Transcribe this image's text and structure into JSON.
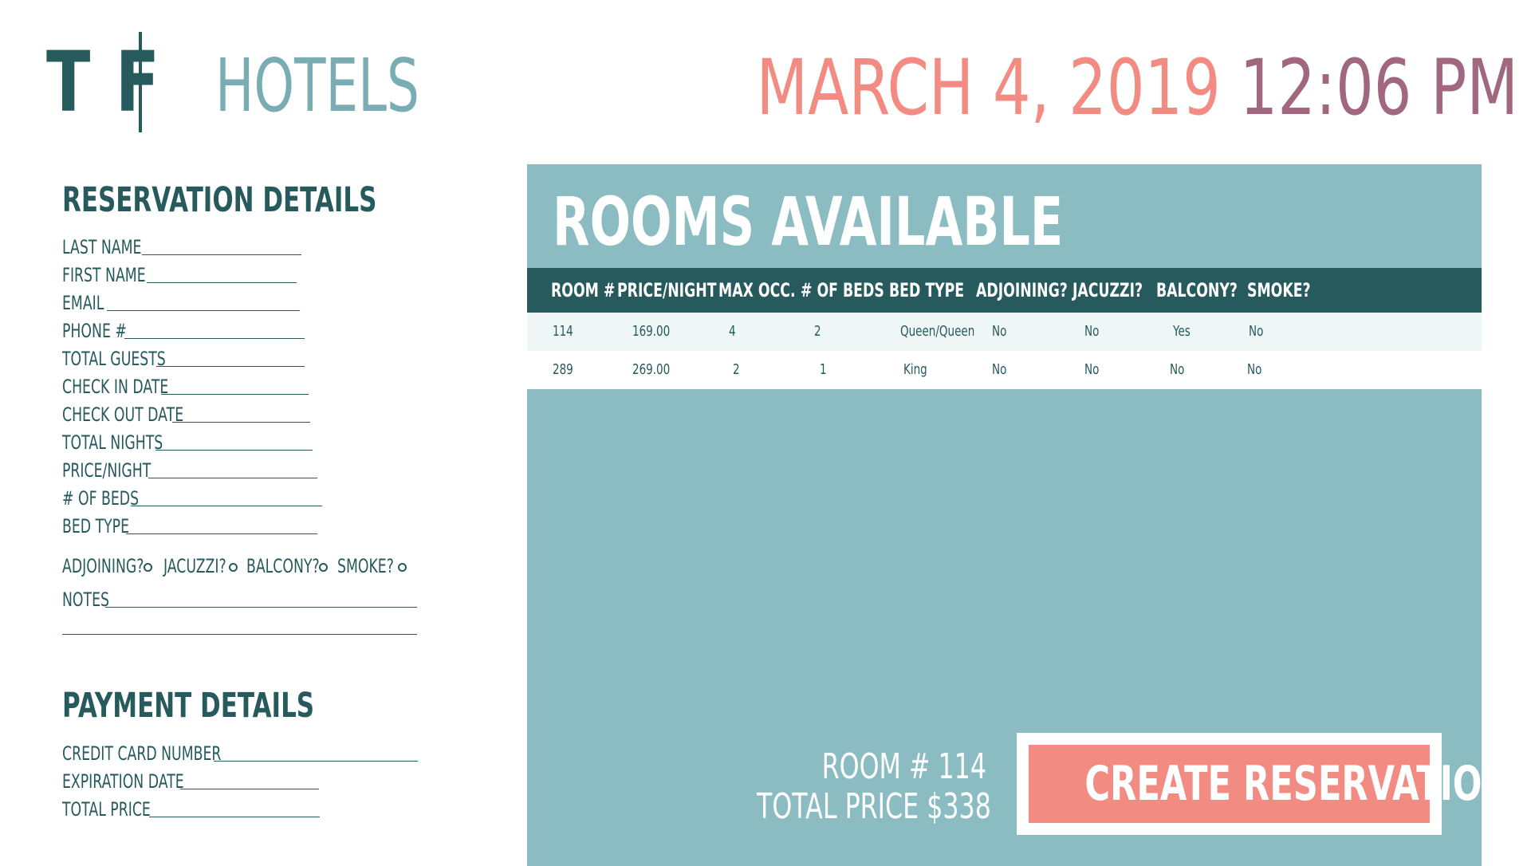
{
  "header": {
    "logo_mark": "T F",
    "logo_text": "HOTELS",
    "date": "MARCH 4, 2019",
    "time": "12:06 PM"
  },
  "reservation": {
    "title": "RESERVATION DETAILS",
    "fields": [
      {
        "label": "LAST NAME",
        "value": ""
      },
      {
        "label": "FIRST NAME",
        "value": ""
      },
      {
        "label": "EMAIL",
        "value": ""
      },
      {
        "label": "PHONE #",
        "value": ""
      },
      {
        "label": "TOTAL GUESTS",
        "value": ""
      },
      {
        "label": "CHECK IN DATE",
        "value": ""
      },
      {
        "label": "CHECK OUT DATE",
        "value": ""
      },
      {
        "label": "TOTAL NIGHTS",
        "value": ""
      },
      {
        "label": "PRICE/NIGHT",
        "value": ""
      },
      {
        "label": "# OF BEDS",
        "value": ""
      },
      {
        "label": "BED TYPE",
        "value": ""
      }
    ],
    "options": [
      {
        "label": "ADJOINING?",
        "checked": false
      },
      {
        "label": "JACUZZI?",
        "checked": false
      },
      {
        "label": "BALCONY?",
        "checked": false
      },
      {
        "label": "SMOKE?",
        "checked": false
      }
    ],
    "notes_label": "NOTES"
  },
  "payment": {
    "title": "PAYMENT DETAILS",
    "fields": [
      {
        "label": "CREDIT CARD NUMBER",
        "value": ""
      },
      {
        "label": "EXPIRATION DATE",
        "value": ""
      },
      {
        "label": "TOTAL PRICE",
        "value": ""
      }
    ]
  },
  "rooms": {
    "title": "ROOMS AVAILABLE",
    "columns": [
      "ROOM #",
      "PRICE/NIGHT",
      "MAX OCC.",
      "# OF BEDS",
      "BED TYPE",
      "ADJOINING?",
      "JACUZZI?",
      "BALCONY?",
      "SMOKE?"
    ],
    "rows": [
      [
        "114",
        "169.00",
        "4",
        "2",
        "Queen/Queen",
        "No",
        "No",
        "Yes",
        "No"
      ],
      [
        "289",
        "269.00",
        "2",
        "1",
        "King",
        "No",
        "No",
        "No",
        "No"
      ]
    ]
  },
  "summary": {
    "room_line": "ROOM # 114",
    "price_line": "TOTAL PRICE $338"
  },
  "actions": {
    "create_label": "CREATE RESERVATION"
  },
  "colors": {
    "primary_dark": "#265a5c",
    "panel_teal": "#8bbcc2",
    "logo_teal": "#79adb3",
    "accent_coral": "#f28b82",
    "time_mauve": "#a0677f"
  }
}
